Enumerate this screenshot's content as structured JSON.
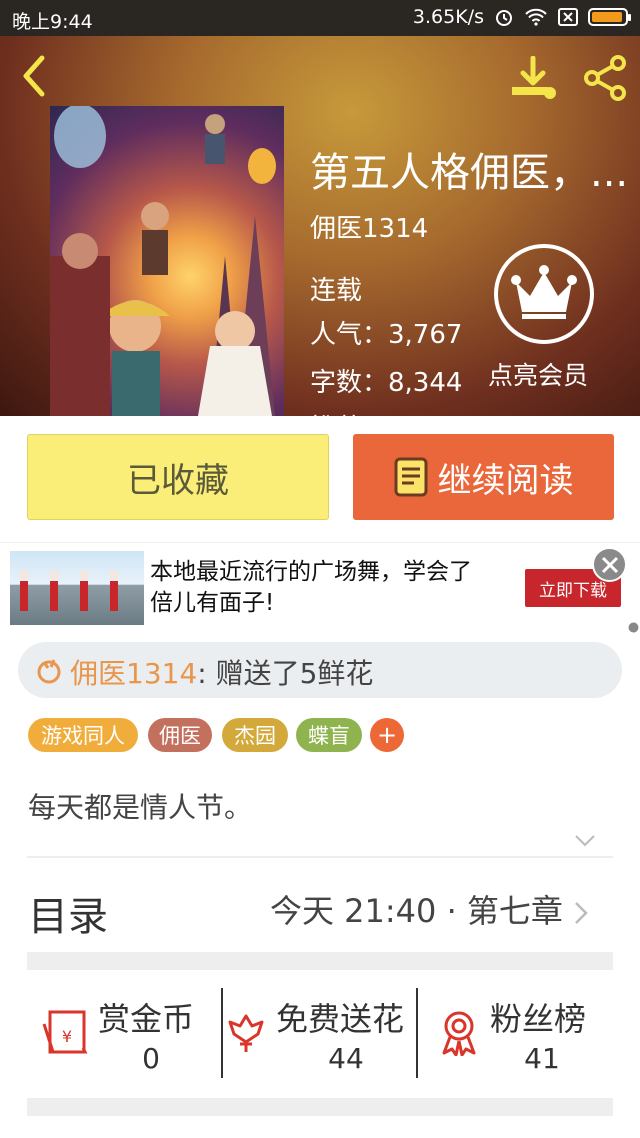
{
  "status_bar": {
    "time": "晚上9:44",
    "speed": "3.65K/s"
  },
  "book": {
    "title": "第五人格佣医，...",
    "author": "佣医1314",
    "status": "连载",
    "popularity": "人气：3,767",
    "word_count": "字数：8,344",
    "cut_line": "推荐：..."
  },
  "vip": {
    "label": "点亮会员"
  },
  "actions": {
    "collected": "已收藏",
    "continue": "继续阅读"
  },
  "ad": {
    "text_line1": "本地最近流行的广场舞，学会了",
    "text_line2": "倍儿有面子!",
    "button": "立即下载"
  },
  "gift": {
    "user": "佣医1314",
    "text": ": 赠送了5鲜花"
  },
  "tags": [
    {
      "label": "游戏同人",
      "color": "#f1ad3c"
    },
    {
      "label": "佣医",
      "color": "#c4705e"
    },
    {
      "label": "杰园",
      "color": "#d2a93a"
    },
    {
      "label": "蝶盲",
      "color": "#8fb44f"
    }
  ],
  "tag_add": "+",
  "description": "每天都是情人节。",
  "toc": {
    "label": "目录",
    "latest": "今天 21:40 · 第七章"
  },
  "stats": [
    {
      "label": "赏金币",
      "value": "0",
      "icon": "red-envelope-icon"
    },
    {
      "label": "免费送花",
      "value": "44",
      "icon": "flower-icon"
    },
    {
      "label": "粉丝榜",
      "value": "41",
      "icon": "medal-icon"
    }
  ],
  "colors": {
    "accent": "#e9673b",
    "gift_user": "#e9964d",
    "stat_icon": "#d9352b"
  }
}
